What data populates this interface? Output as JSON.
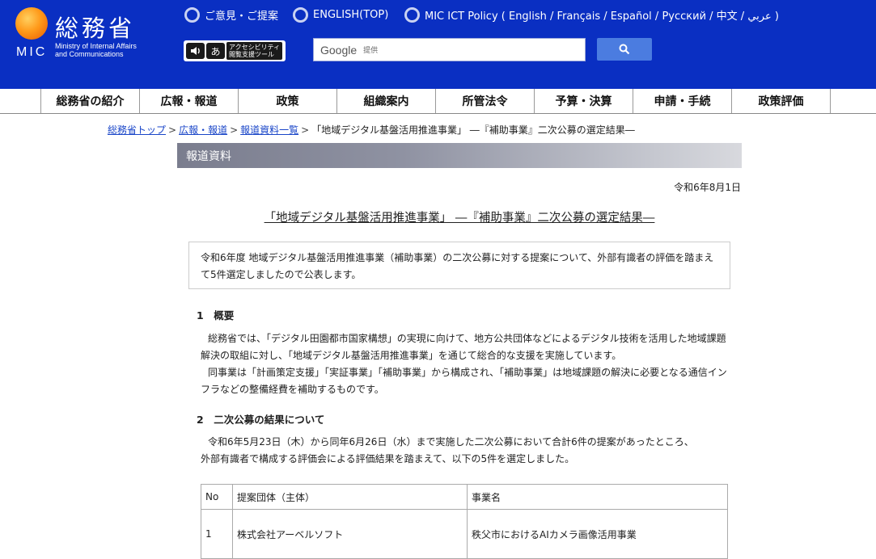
{
  "header": {
    "logo": {
      "kanji": "総務省",
      "abbr": "MIC",
      "english_line1": "Ministry of Internal Affairs",
      "english_line2": "and Communications"
    },
    "top_links": [
      {
        "label": "ご意見・ご提案"
      },
      {
        "label": "ENGLISH(TOP)"
      },
      {
        "label": "MIC ICT Policy ( English / Français / Español / Русский / 中文 / عربي )"
      }
    ],
    "accessibility": {
      "label_line1": "アクセシビリティ",
      "label_line2": "閲覧支援ツール"
    },
    "search": {
      "brand": "Google",
      "provided": "提供"
    }
  },
  "nav": {
    "items": [
      "総務省の紹介",
      "広報・報道",
      "政策",
      "組織案内",
      "所管法令",
      "予算・決算",
      "申請・手続",
      "政策評価"
    ]
  },
  "breadcrumb": {
    "items": [
      "総務省トップ",
      "広報・報道",
      "報道資料一覧"
    ],
    "separator": ">",
    "current": "「地域デジタル基盤活用推進事業」 ―『補助事業』二次公募の選定結果―"
  },
  "content": {
    "section_label": "報道資料",
    "date": "令和6年8月1日",
    "title": "「地域デジタル基盤活用推進事業」 ―『補助事業』二次公募の選定結果―",
    "summary": "令和6年度 地域デジタル基盤活用推進事業（補助事業）の二次公募に対する提案について、外部有識者の評価を踏まえて5件選定しましたので公表します。",
    "section1": {
      "heading": "1　概要",
      "para1": "総務省では、「デジタル田園都市国家構想」の実現に向けて、地方公共団体などによるデジタル技術を活用した地域課題解決の取組に対し、「地域デジタル基盤活用推進事業」を通じて総合的な支援を実施しています。",
      "para2": "同事業は「計画策定支援」「実証事業」「補助事業」から構成され、「補助事業」は地域課題の解決に必要となる通信インフラなどの整備経費を補助するものです。"
    },
    "section2": {
      "heading": "2　二次公募の結果について",
      "para1": "令和6年5月23日（木）から同年6月26日（水）まで実施した二次公募において合計6件の提案があったところ、",
      "para2": "外部有識者で構成する評価会による評価結果を踏まえて、以下の5件を選定しました。"
    },
    "table": {
      "headers": [
        "No",
        "提案団体（主体）",
        "事業名"
      ],
      "rows": [
        {
          "no": "1",
          "org": "株式会社アーベルソフト",
          "project": "秩父市におけるAIカメラ画像活用事業"
        }
      ]
    }
  }
}
